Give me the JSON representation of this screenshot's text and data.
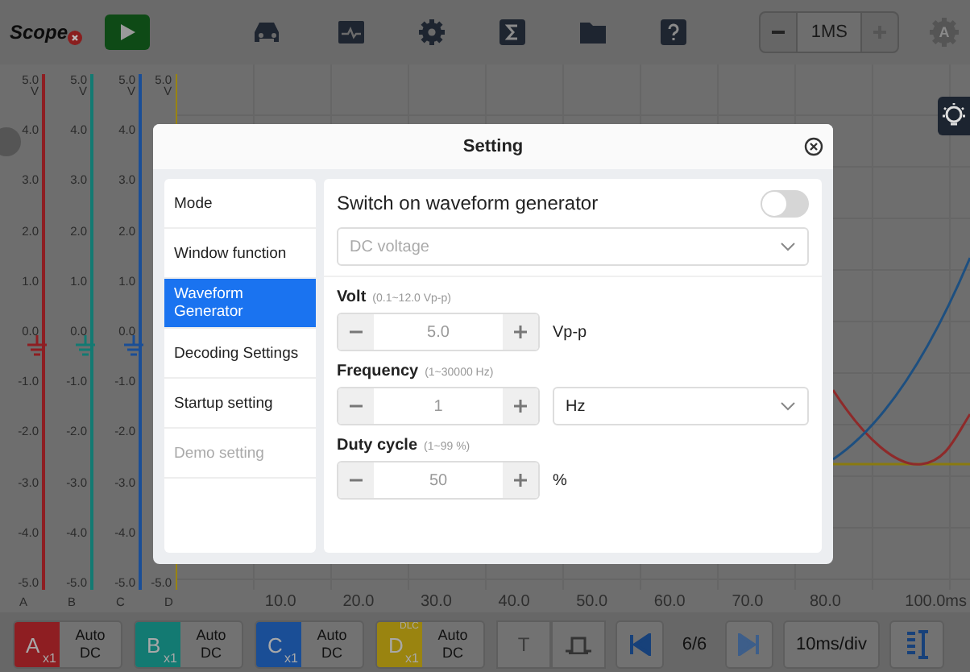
{
  "toolbar": {
    "logo": "Scope",
    "timebase": "1MS",
    "gear_badge": "A"
  },
  "axes": [
    {
      "label": "A",
      "unit": "V",
      "color": "#8e1e22",
      "ticks": [
        "5.0",
        "4.0",
        "3.0",
        "2.0",
        "1.0",
        "0.0",
        "-1.0",
        "-2.0",
        "-3.0",
        "-4.0",
        "-5.0"
      ]
    },
    {
      "label": "B",
      "unit": "V",
      "color": "#137a72",
      "ticks": [
        "5.0",
        "4.0",
        "3.0",
        "2.0",
        "1.0",
        "0.0",
        "-1.0",
        "-2.0",
        "-3.0",
        "-4.0",
        "-5.0"
      ]
    },
    {
      "label": "C",
      "unit": "V",
      "color": "#1a4e96",
      "ticks": [
        "5.0",
        "4.0",
        "3.0",
        "2.0",
        "1.0",
        "0.0",
        "-1.0",
        "-2.0",
        "-3.0",
        "-4.0",
        "-5.0"
      ]
    },
    {
      "label": "D",
      "unit": "V",
      "color": "#9a8410",
      "ticks": [
        "5.0",
        "-5.0"
      ]
    }
  ],
  "x_labels": [
    "10.0",
    "20.0",
    "30.0",
    "40.0",
    "50.0",
    "60.0",
    "70.0",
    "80.0",
    "100.0ms"
  ],
  "channels": [
    {
      "letter": "A",
      "probe": "x1",
      "mode": "Auto DC",
      "color": "#8e1e22"
    },
    {
      "letter": "B",
      "probe": "x1",
      "mode": "Auto DC",
      "color": "#137a72"
    },
    {
      "letter": "C",
      "probe": "x1",
      "mode": "Auto DC",
      "color": "#1a4e96"
    },
    {
      "letter": "D",
      "probe": "x1",
      "mode": "Auto DC",
      "color": "#9a8410",
      "tag": "DLC"
    }
  ],
  "trigger": "T",
  "page": "6/6",
  "scale": "10ms/div",
  "dialog": {
    "title": "Setting",
    "menu": [
      {
        "label": "Mode",
        "selected": false,
        "disabled": false
      },
      {
        "label": "Window function",
        "selected": false,
        "disabled": false
      },
      {
        "label": "Waveform Generator",
        "selected": true,
        "disabled": false
      },
      {
        "label": "Decoding Settings",
        "selected": false,
        "disabled": false
      },
      {
        "label": "Startup setting",
        "selected": false,
        "disabled": false
      },
      {
        "label": "Demo setting",
        "selected": false,
        "disabled": true
      }
    ],
    "generator": {
      "label": "Switch on waveform generator",
      "on": false,
      "waveform": "DC voltage",
      "params": [
        {
          "kind": "text",
          "label": "Volt",
          "range": "(0.1~12.0 Vp-p)",
          "value": "5.0",
          "unit": "Vp-p"
        },
        {
          "kind": "select",
          "label": "Frequency",
          "range": "(1~30000 Hz)",
          "value": "1",
          "unit": "Hz"
        },
        {
          "kind": "text",
          "label": "Duty cycle",
          "range": "(1~99 %)",
          "value": "50",
          "unit": "%"
        }
      ]
    }
  }
}
